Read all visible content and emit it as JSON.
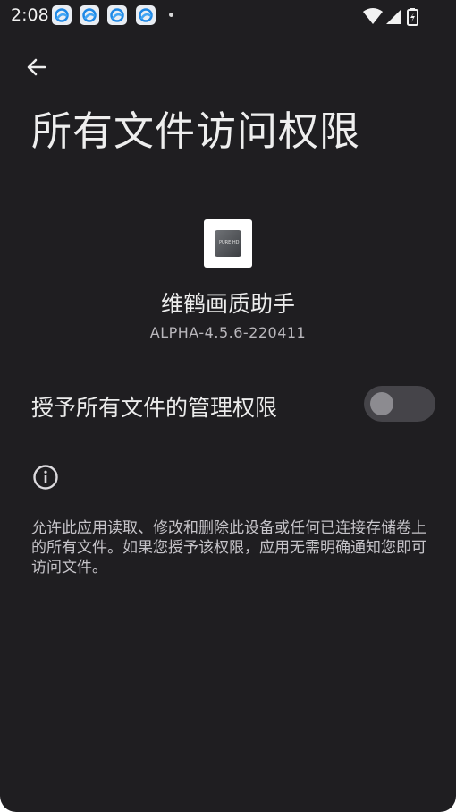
{
  "status_bar": {
    "time": "2:08",
    "notification_icons": [
      "app-notification-icon",
      "app-notification-icon",
      "app-notification-icon",
      "app-notification-icon"
    ],
    "icons": [
      "wifi-icon",
      "cell-signal-icon",
      "battery-charging-icon"
    ]
  },
  "header": {
    "back_icon": "arrow-left-icon",
    "title": "所有文件访问权限"
  },
  "app": {
    "icon": "app-icon",
    "icon_text": "PURE HD",
    "name": "维鹤画质助手",
    "version": "ALPHA-4.5.6-220411"
  },
  "permission": {
    "label": "授予所有文件的管理权限",
    "enabled": false
  },
  "info": {
    "icon": "info-icon",
    "description": "允许此应用读取、修改和删除此设备或任何已连接存储卷上的所有文件。如果您授予该权限，应用无需明确通知您即可访问文件。"
  },
  "colors": {
    "background": "#1f1e21",
    "text_primary": "#eeeeee",
    "text_secondary": "#c6c4c9",
    "switch_track_off": "#454449",
    "switch_thumb_off": "#8c8b90"
  }
}
